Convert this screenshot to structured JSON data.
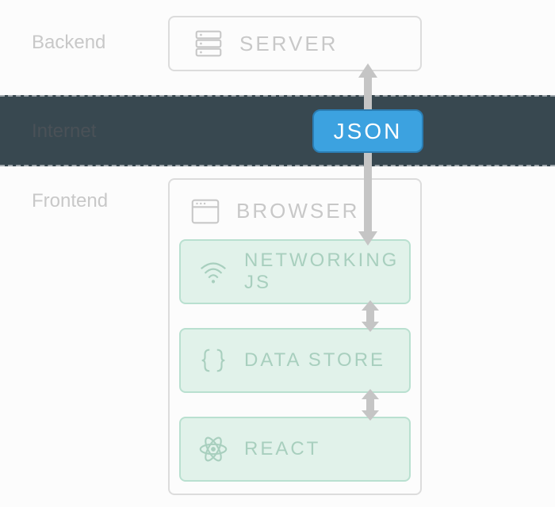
{
  "tiers": {
    "backend": "Backend",
    "internet": "Internet",
    "frontend": "Frontend"
  },
  "nodes": {
    "server": "SERVER",
    "json": "JSON",
    "browser": "BROWSER",
    "networking": "NETWORKING JS",
    "datastore": "DATA STORE",
    "react": "REACT"
  }
}
